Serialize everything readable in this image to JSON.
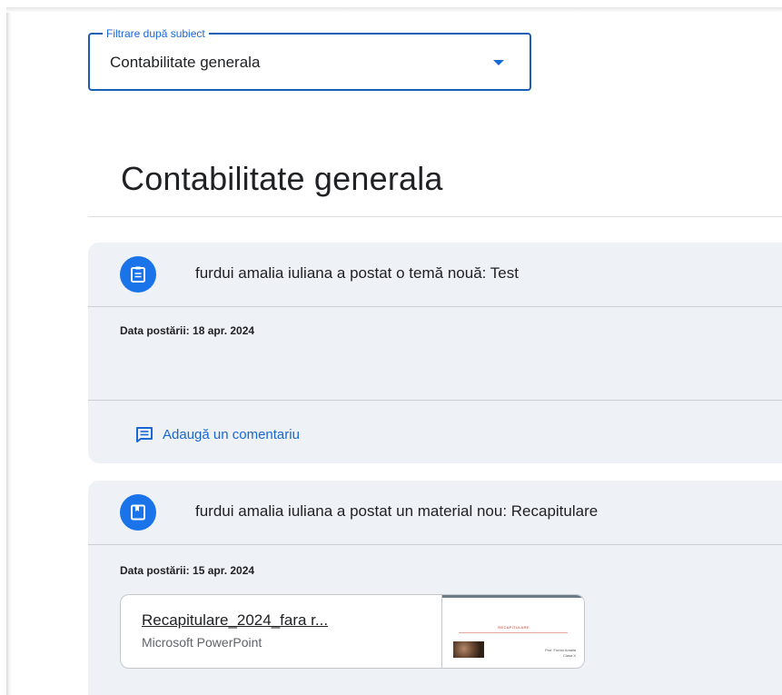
{
  "filter": {
    "legend": "Filtrare după subiect",
    "value": "Contabilitate generala"
  },
  "page_title": "Contabilitate generala",
  "posts": [
    {
      "header": "furdui amalia iuliana a postat o temă nouă: Test",
      "icon": "assignment-icon",
      "date": "Data postării: 18 apr. 2024",
      "comment_label": "Adaugă un comentariu"
    },
    {
      "header": "furdui amalia iuliana a postat un material nou: Recapitulare",
      "icon": "material-icon",
      "date": "Data postării: 15 apr. 2024",
      "attachment": {
        "name": "Recapitulare_2024_fara r...",
        "type": "Microsoft PowerPoint",
        "thumb_title": "RECAPITULARE",
        "thumb_caption_1": "Prof. Furdui Amalia",
        "thumb_caption_2": "Clasa X"
      }
    }
  ],
  "colors": {
    "accent": "#1a73e8",
    "card_bg": "#eef2f7",
    "link": "#1967d2"
  }
}
